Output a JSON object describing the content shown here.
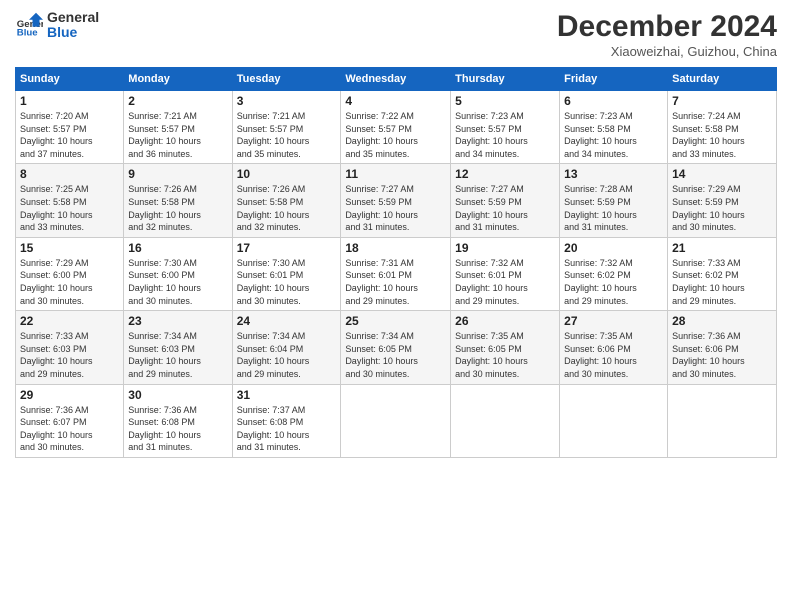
{
  "logo": {
    "name_part1": "General",
    "name_part2": "Blue"
  },
  "title": "December 2024",
  "subtitle": "Xiaoweizhai, Guizhou, China",
  "weekdays": [
    "Sunday",
    "Monday",
    "Tuesday",
    "Wednesday",
    "Thursday",
    "Friday",
    "Saturday"
  ],
  "weeks": [
    [
      {
        "day": "1",
        "info": "Sunrise: 7:20 AM\nSunset: 5:57 PM\nDaylight: 10 hours\nand 37 minutes."
      },
      {
        "day": "2",
        "info": "Sunrise: 7:21 AM\nSunset: 5:57 PM\nDaylight: 10 hours\nand 36 minutes."
      },
      {
        "day": "3",
        "info": "Sunrise: 7:21 AM\nSunset: 5:57 PM\nDaylight: 10 hours\nand 35 minutes."
      },
      {
        "day": "4",
        "info": "Sunrise: 7:22 AM\nSunset: 5:57 PM\nDaylight: 10 hours\nand 35 minutes."
      },
      {
        "day": "5",
        "info": "Sunrise: 7:23 AM\nSunset: 5:57 PM\nDaylight: 10 hours\nand 34 minutes."
      },
      {
        "day": "6",
        "info": "Sunrise: 7:23 AM\nSunset: 5:58 PM\nDaylight: 10 hours\nand 34 minutes."
      },
      {
        "day": "7",
        "info": "Sunrise: 7:24 AM\nSunset: 5:58 PM\nDaylight: 10 hours\nand 33 minutes."
      }
    ],
    [
      {
        "day": "8",
        "info": "Sunrise: 7:25 AM\nSunset: 5:58 PM\nDaylight: 10 hours\nand 33 minutes."
      },
      {
        "day": "9",
        "info": "Sunrise: 7:26 AM\nSunset: 5:58 PM\nDaylight: 10 hours\nand 32 minutes."
      },
      {
        "day": "10",
        "info": "Sunrise: 7:26 AM\nSunset: 5:58 PM\nDaylight: 10 hours\nand 32 minutes."
      },
      {
        "day": "11",
        "info": "Sunrise: 7:27 AM\nSunset: 5:59 PM\nDaylight: 10 hours\nand 31 minutes."
      },
      {
        "day": "12",
        "info": "Sunrise: 7:27 AM\nSunset: 5:59 PM\nDaylight: 10 hours\nand 31 minutes."
      },
      {
        "day": "13",
        "info": "Sunrise: 7:28 AM\nSunset: 5:59 PM\nDaylight: 10 hours\nand 31 minutes."
      },
      {
        "day": "14",
        "info": "Sunrise: 7:29 AM\nSunset: 5:59 PM\nDaylight: 10 hours\nand 30 minutes."
      }
    ],
    [
      {
        "day": "15",
        "info": "Sunrise: 7:29 AM\nSunset: 6:00 PM\nDaylight: 10 hours\nand 30 minutes."
      },
      {
        "day": "16",
        "info": "Sunrise: 7:30 AM\nSunset: 6:00 PM\nDaylight: 10 hours\nand 30 minutes."
      },
      {
        "day": "17",
        "info": "Sunrise: 7:30 AM\nSunset: 6:01 PM\nDaylight: 10 hours\nand 30 minutes."
      },
      {
        "day": "18",
        "info": "Sunrise: 7:31 AM\nSunset: 6:01 PM\nDaylight: 10 hours\nand 29 minutes."
      },
      {
        "day": "19",
        "info": "Sunrise: 7:32 AM\nSunset: 6:01 PM\nDaylight: 10 hours\nand 29 minutes."
      },
      {
        "day": "20",
        "info": "Sunrise: 7:32 AM\nSunset: 6:02 PM\nDaylight: 10 hours\nand 29 minutes."
      },
      {
        "day": "21",
        "info": "Sunrise: 7:33 AM\nSunset: 6:02 PM\nDaylight: 10 hours\nand 29 minutes."
      }
    ],
    [
      {
        "day": "22",
        "info": "Sunrise: 7:33 AM\nSunset: 6:03 PM\nDaylight: 10 hours\nand 29 minutes."
      },
      {
        "day": "23",
        "info": "Sunrise: 7:34 AM\nSunset: 6:03 PM\nDaylight: 10 hours\nand 29 minutes."
      },
      {
        "day": "24",
        "info": "Sunrise: 7:34 AM\nSunset: 6:04 PM\nDaylight: 10 hours\nand 29 minutes."
      },
      {
        "day": "25",
        "info": "Sunrise: 7:34 AM\nSunset: 6:05 PM\nDaylight: 10 hours\nand 30 minutes."
      },
      {
        "day": "26",
        "info": "Sunrise: 7:35 AM\nSunset: 6:05 PM\nDaylight: 10 hours\nand 30 minutes."
      },
      {
        "day": "27",
        "info": "Sunrise: 7:35 AM\nSunset: 6:06 PM\nDaylight: 10 hours\nand 30 minutes."
      },
      {
        "day": "28",
        "info": "Sunrise: 7:36 AM\nSunset: 6:06 PM\nDaylight: 10 hours\nand 30 minutes."
      }
    ],
    [
      {
        "day": "29",
        "info": "Sunrise: 7:36 AM\nSunset: 6:07 PM\nDaylight: 10 hours\nand 30 minutes."
      },
      {
        "day": "30",
        "info": "Sunrise: 7:36 AM\nSunset: 6:08 PM\nDaylight: 10 hours\nand 31 minutes."
      },
      {
        "day": "31",
        "info": "Sunrise: 7:37 AM\nSunset: 6:08 PM\nDaylight: 10 hours\nand 31 minutes."
      },
      {
        "day": "",
        "info": ""
      },
      {
        "day": "",
        "info": ""
      },
      {
        "day": "",
        "info": ""
      },
      {
        "day": "",
        "info": ""
      }
    ]
  ]
}
